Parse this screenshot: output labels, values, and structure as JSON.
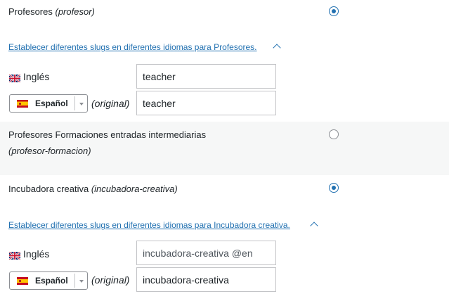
{
  "items": [
    {
      "label": "Profesores",
      "slug": "(profesor)",
      "selected": true,
      "toggle_text": "Establecer diferentes slugs en diferentes idiomas para Profesores.",
      "translations": {
        "english_label": "Inglés",
        "english_value": "teacher",
        "english_placeholder": "",
        "spanish_select": "Español",
        "original_note": "(original)",
        "spanish_value": "teacher"
      }
    },
    {
      "label": "Profesores Formaciones entradas intermediarias",
      "slug": "(profesor-formacion)",
      "selected": false
    },
    {
      "label": "Incubadora creativa",
      "slug": "(incubadora-creativa)",
      "selected": true,
      "toggle_text": "Establecer diferentes slugs en diferentes idiomas para Incubadora creativa.",
      "translations": {
        "english_label": "Inglés",
        "english_value": "",
        "english_placeholder": "incubadora-creativa @en",
        "spanish_select": "Español",
        "original_note": "(original)",
        "spanish_value": "incubadora-creativa"
      }
    }
  ],
  "icons": {
    "uk_flag": "uk-flag-icon",
    "es_flag": "spain-flag-icon",
    "chevron": "chevron-up-icon"
  },
  "colors": {
    "accent": "#2271b1",
    "alt_row": "#f6f7f7"
  }
}
